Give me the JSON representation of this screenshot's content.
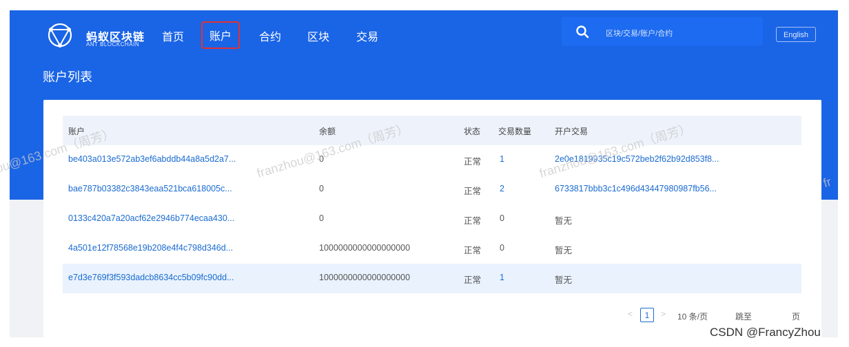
{
  "brand": {
    "name": "蚂蚁区块链",
    "sub": "ANT BLOCKCHAIN"
  },
  "nav": [
    {
      "label": "首页"
    },
    {
      "label": "账户"
    },
    {
      "label": "合约"
    },
    {
      "label": "区块"
    },
    {
      "label": "交易"
    }
  ],
  "search": {
    "placeholder": "区块/交易/账户/合约"
  },
  "lang_button": "English",
  "page_title": "账户列表",
  "table": {
    "headers": [
      "账户",
      "余额",
      "状态",
      "交易数量",
      "开户交易"
    ],
    "rows": [
      {
        "account": "be403a013e572ab3ef6abddb44a8a5d2a7...",
        "balance": "0",
        "status": "正常",
        "tx_count": "1",
        "open_tx": "2e0e1819935c19c572beb2f62b92d853f8..."
      },
      {
        "account": "bae787b03382c3843eaa521bca618005c...",
        "balance": "0",
        "status": "正常",
        "tx_count": "2",
        "open_tx": "6733817bbb3c1c496d43447980987fb56..."
      },
      {
        "account": "0133c420a7a20acf62e2946b774ecaa430...",
        "balance": "0",
        "status": "正常",
        "tx_count": "0",
        "open_tx": "暂无"
      },
      {
        "account": "4a501e12f78568e19b208e4f4c798d346d...",
        "balance": "1000000000000000000",
        "status": "正常",
        "tx_count": "0",
        "open_tx": "暂无"
      },
      {
        "account": "e7d3e769f3f593dadcb8634cc5b09fc90dd...",
        "balance": "1000000000000000000",
        "status": "正常",
        "tx_count": "1",
        "open_tx": "暂无"
      }
    ]
  },
  "pagination": {
    "prev": "<",
    "current": "1",
    "next": ">",
    "page_size": "10 条/页",
    "jump_label": "跳至",
    "page_label": "页"
  },
  "watermarks": [
    "ou@163.com（周芳）",
    "franzhou@163.com（周芳）",
    "franzhou@163.com（周芳）",
    "fr"
  ],
  "footer_credit": "CSDN @FrancyZhou",
  "colors": {
    "header_blue": "#1a64e6",
    "link": "#1a6bd1",
    "active_outline": "#e03232"
  }
}
